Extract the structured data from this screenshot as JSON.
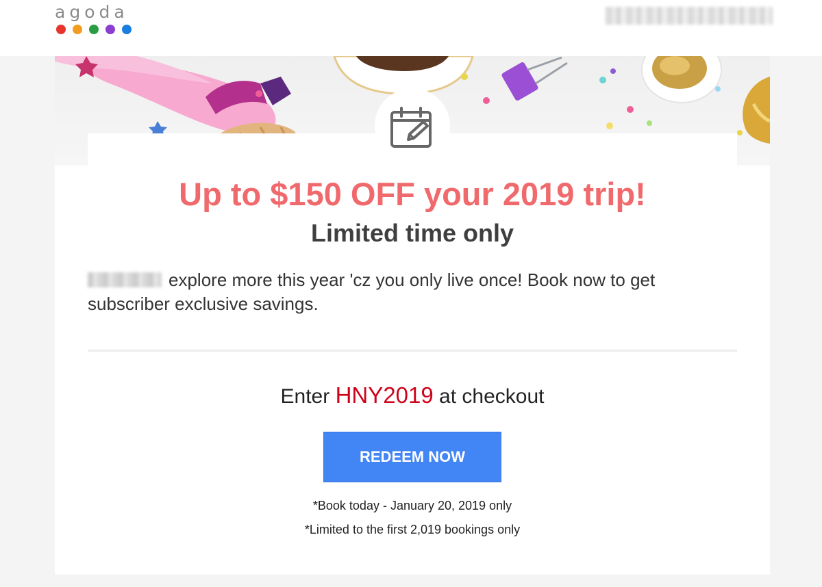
{
  "brand": {
    "logo_text": "agoda",
    "dot_colors": [
      "#e8352b",
      "#f39c1f",
      "#2a9d43",
      "#8a3fd1",
      "#1a7de0"
    ]
  },
  "email": {
    "icon": "calendar-edit-icon",
    "headline": "Up to $150 OFF your 2019 trip!",
    "subheadline": "Limited time only",
    "body": "explore more this year 'cz you only live once! Book now to get subscriber exclusive savings.",
    "promo_prefix": "Enter",
    "promo_code": "HNY2019",
    "promo_suffix": "at checkout",
    "cta_label": "REDEEM NOW",
    "fine_print": [
      "*Book today - January 20, 2019 only",
      "*Limited to the first 2,019 bookings only"
    ]
  },
  "colors": {
    "headline": "#f06a6d",
    "promo_code": "#d0021b",
    "cta": "#4285f4"
  }
}
